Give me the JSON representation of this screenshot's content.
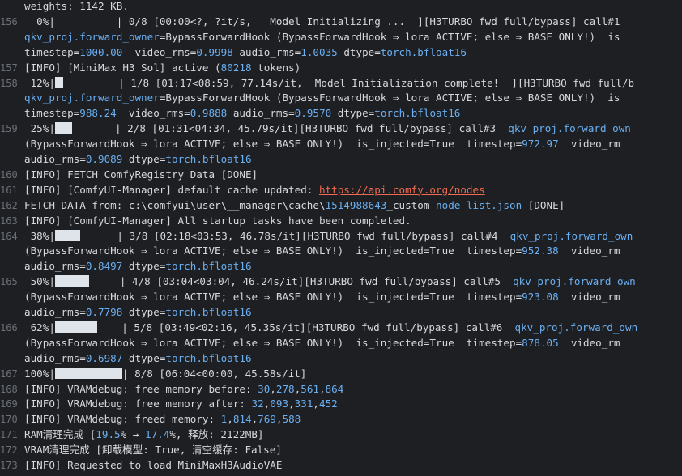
{
  "colors": {
    "background": "#1e1f22",
    "text": "#d6d8dc",
    "number": "#6aaff2",
    "link": "#f06b4f",
    "line_number": "#6b7078",
    "progress_fill": "#dfe3ea"
  },
  "lines": [
    {
      "ln": "",
      "segs": [
        {
          "t": "weights: 1142 KB.",
          "c": "default"
        }
      ]
    },
    {
      "ln": "156",
      "segs": [
        {
          "t": "  0%|",
          "c": "default"
        },
        {
          "t": "",
          "bar": 0.0
        },
        {
          "t": "          | 0/8 [00:00<?, ?it/s,   Model Initializing ...  ][H3TURBO fwd full/bypass] call#1",
          "c": "default"
        }
      ]
    },
    {
      "ln": "",
      "segs": [
        {
          "t": "qkv_proj.forward_owner",
          "c": "num"
        },
        {
          "t": "=BypassForwardHook (BypassForwardHook ⇒ lora ACTIVE; else ⇒ BASE ONLY!)  is",
          "c": "default"
        }
      ]
    },
    {
      "ln": "",
      "segs": [
        {
          "t": "timestep=",
          "c": "default"
        },
        {
          "t": "1000.00",
          "c": "num"
        },
        {
          "t": "  video_rms=",
          "c": "default"
        },
        {
          "t": "0.9998",
          "c": "num"
        },
        {
          "t": " audio_rms=",
          "c": "default"
        },
        {
          "t": "1.0035",
          "c": "num"
        },
        {
          "t": " dtype=",
          "c": "default"
        },
        {
          "t": "torch.bfloat16",
          "c": "num"
        }
      ]
    },
    {
      "ln": "157",
      "segs": [
        {
          "t": "[INFO] [MiniMax H3 Sol] active (",
          "c": "default"
        },
        {
          "t": "80218",
          "c": "num"
        },
        {
          "t": " tokens)",
          "c": "default"
        }
      ]
    },
    {
      "ln": "158",
      "segs": [
        {
          "t": " 12%|",
          "c": "default"
        },
        {
          "t": "",
          "bar": 0.12
        },
        {
          "t": "         | 1/8 [01:17<08:59, 77.14s/it,  Model Initialization complete!  ][H3TURBO fwd full/b",
          "c": "default"
        }
      ]
    },
    {
      "ln": "",
      "segs": [
        {
          "t": "qkv_proj.forward_owner",
          "c": "num"
        },
        {
          "t": "=BypassForwardHook (BypassForwardHook ⇒ lora ACTIVE; else ⇒ BASE ONLY!)  is",
          "c": "default"
        }
      ]
    },
    {
      "ln": "",
      "segs": [
        {
          "t": "timestep=",
          "c": "default"
        },
        {
          "t": "988.24",
          "c": "num"
        },
        {
          "t": "  video_rms=",
          "c": "default"
        },
        {
          "t": "0.9888",
          "c": "num"
        },
        {
          "t": " audio_rms=",
          "c": "default"
        },
        {
          "t": "0.9570",
          "c": "num"
        },
        {
          "t": " dtype=",
          "c": "default"
        },
        {
          "t": "torch.bfloat16",
          "c": "num"
        }
      ]
    },
    {
      "ln": "159",
      "segs": [
        {
          "t": " 25%|",
          "c": "default"
        },
        {
          "t": "",
          "bar": 0.25
        },
        {
          "t": "       | 2/8 [01:31<04:34, 45.79s/it][H3TURBO fwd full/bypass] call#3  ",
          "c": "default"
        },
        {
          "t": "qkv_proj.forward_own",
          "c": "num"
        }
      ]
    },
    {
      "ln": "",
      "segs": [
        {
          "t": "(BypassForwardHook ⇒ lora ACTIVE; else ⇒ BASE ONLY!)  is_injected=True  timestep=",
          "c": "default"
        },
        {
          "t": "972.97",
          "c": "num"
        },
        {
          "t": "  video_rm",
          "c": "default"
        }
      ]
    },
    {
      "ln": "",
      "segs": [
        {
          "t": "audio_rms=",
          "c": "default"
        },
        {
          "t": "0.9089",
          "c": "num"
        },
        {
          "t": " dtype=",
          "c": "default"
        },
        {
          "t": "torch.bfloat16",
          "c": "num"
        }
      ]
    },
    {
      "ln": "160",
      "segs": [
        {
          "t": "[INFO] FETCH ComfyRegistry Data [DONE]",
          "c": "default"
        }
      ]
    },
    {
      "ln": "161",
      "segs": [
        {
          "t": "[INFO] [ComfyUI-Manager] default cache updated: ",
          "c": "default"
        },
        {
          "t": "https://api.comfy.org/nodes",
          "c": "link"
        }
      ]
    },
    {
      "ln": "162",
      "segs": [
        {
          "t": "FETCH DATA from: c:\\comfyui\\user\\__manager\\cache\\",
          "c": "default"
        },
        {
          "t": "1514988643",
          "c": "num"
        },
        {
          "t": "_custom-",
          "c": "default"
        },
        {
          "t": "node-list.json",
          "c": "num"
        },
        {
          "t": " [DONE]",
          "c": "default"
        }
      ]
    },
    {
      "ln": "163",
      "segs": [
        {
          "t": "[INFO] [ComfyUI-Manager] All startup tasks have been completed.",
          "c": "default"
        }
      ]
    },
    {
      "ln": "164",
      "segs": [
        {
          "t": " 38%|",
          "c": "default"
        },
        {
          "t": "",
          "bar": 0.375
        },
        {
          "t": "      | 3/8 [02:18<03:53, 46.78s/it][H3TURBO fwd full/bypass] call#4  ",
          "c": "default"
        },
        {
          "t": "qkv_proj.forward_own",
          "c": "num"
        }
      ]
    },
    {
      "ln": "",
      "segs": [
        {
          "t": "(BypassForwardHook ⇒ lora ACTIVE; else ⇒ BASE ONLY!)  is_injected=True  timestep=",
          "c": "default"
        },
        {
          "t": "952.38",
          "c": "num"
        },
        {
          "t": "  video_rm",
          "c": "default"
        }
      ]
    },
    {
      "ln": "",
      "segs": [
        {
          "t": "audio_rms=",
          "c": "default"
        },
        {
          "t": "0.8497",
          "c": "num"
        },
        {
          "t": " dtype=",
          "c": "default"
        },
        {
          "t": "torch.bfloat16",
          "c": "num"
        }
      ]
    },
    {
      "ln": "165",
      "segs": [
        {
          "t": " 50%|",
          "c": "default"
        },
        {
          "t": "",
          "bar": 0.5
        },
        {
          "t": "     | 4/8 [03:04<03:04, 46.24s/it][H3TURBO fwd full/bypass] call#5  ",
          "c": "default"
        },
        {
          "t": "qkv_proj.forward_own",
          "c": "num"
        }
      ]
    },
    {
      "ln": "",
      "segs": [
        {
          "t": "(BypassForwardHook ⇒ lora ACTIVE; else ⇒ BASE ONLY!)  is_injected=True  timestep=",
          "c": "default"
        },
        {
          "t": "923.08",
          "c": "num"
        },
        {
          "t": "  video_rm",
          "c": "default"
        }
      ]
    },
    {
      "ln": "",
      "segs": [
        {
          "t": "audio_rms=",
          "c": "default"
        },
        {
          "t": "0.7798",
          "c": "num"
        },
        {
          "t": " dtype=",
          "c": "default"
        },
        {
          "t": "torch.bfloat16",
          "c": "num"
        }
      ]
    },
    {
      "ln": "166",
      "segs": [
        {
          "t": " 62%|",
          "c": "default"
        },
        {
          "t": "",
          "bar": 0.625
        },
        {
          "t": "    | 5/8 [03:49<02:16, 45.35s/it][H3TURBO fwd full/bypass] call#6  ",
          "c": "default"
        },
        {
          "t": "qkv_proj.forward_own",
          "c": "num"
        }
      ]
    },
    {
      "ln": "",
      "segs": [
        {
          "t": "(BypassForwardHook ⇒ lora ACTIVE; else ⇒ BASE ONLY!)  is_injected=True  timestep=",
          "c": "default"
        },
        {
          "t": "878.05",
          "c": "num"
        },
        {
          "t": "  video_rm",
          "c": "default"
        }
      ]
    },
    {
      "ln": "",
      "segs": [
        {
          "t": "audio_rms=",
          "c": "default"
        },
        {
          "t": "0.6987",
          "c": "num"
        },
        {
          "t": " dtype=",
          "c": "default"
        },
        {
          "t": "torch.bfloat16",
          "c": "num"
        }
      ]
    },
    {
      "ln": "167",
      "segs": [
        {
          "t": "100%|",
          "c": "default"
        },
        {
          "t": "",
          "bar": 1.0
        },
        {
          "t": "| 8/8 [06:04<00:00, 45.58s/it]",
          "c": "default"
        }
      ]
    },
    {
      "ln": "168",
      "segs": [
        {
          "t": "[INFO] VRAMdebug: free memory before: ",
          "c": "default"
        },
        {
          "t": "30",
          "c": "num"
        },
        {
          "t": ",",
          "c": "default"
        },
        {
          "t": "278",
          "c": "num"
        },
        {
          "t": ",",
          "c": "default"
        },
        {
          "t": "561",
          "c": "num"
        },
        {
          "t": ",",
          "c": "default"
        },
        {
          "t": "864",
          "c": "num"
        }
      ]
    },
    {
      "ln": "169",
      "segs": [
        {
          "t": "[INFO] VRAMdebug: free memory after: ",
          "c": "default"
        },
        {
          "t": "32",
          "c": "num"
        },
        {
          "t": ",",
          "c": "default"
        },
        {
          "t": "093",
          "c": "num"
        },
        {
          "t": ",",
          "c": "default"
        },
        {
          "t": "331",
          "c": "num"
        },
        {
          "t": ",",
          "c": "default"
        },
        {
          "t": "452",
          "c": "num"
        }
      ]
    },
    {
      "ln": "170",
      "segs": [
        {
          "t": "[INFO] VRAMdebug: freed memory: ",
          "c": "default"
        },
        {
          "t": "1",
          "c": "num"
        },
        {
          "t": ",",
          "c": "default"
        },
        {
          "t": "814",
          "c": "num"
        },
        {
          "t": ",",
          "c": "default"
        },
        {
          "t": "769",
          "c": "num"
        },
        {
          "t": ",",
          "c": "default"
        },
        {
          "t": "588",
          "c": "num"
        }
      ]
    },
    {
      "ln": "171",
      "segs": [
        {
          "t": "RAM清理完成 [",
          "c": "default"
        },
        {
          "t": "19.5",
          "c": "num"
        },
        {
          "t": "% → ",
          "c": "default"
        },
        {
          "t": "17.4",
          "c": "num"
        },
        {
          "t": "%, 释放: 2122MB]",
          "c": "default"
        }
      ]
    },
    {
      "ln": "172",
      "segs": [
        {
          "t": "VRAM清理完成 [卸载模型: True, 清空缓存: False]",
          "c": "default"
        }
      ]
    },
    {
      "ln": "173",
      "segs": [
        {
          "t": "[INFO] Requested to load MiniMaxH3AudioVAE",
          "c": "default"
        }
      ]
    }
  ]
}
